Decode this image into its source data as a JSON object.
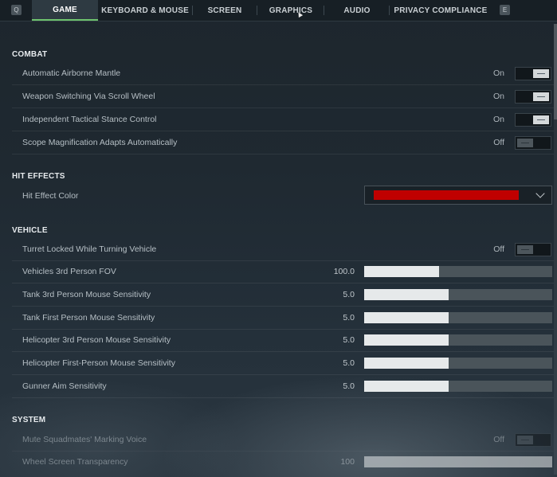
{
  "tabs": {
    "left_key": "Q",
    "right_key": "E",
    "items": [
      {
        "label": "GAME",
        "active": true
      },
      {
        "label": "KEYBOARD & MOUSE",
        "active": false
      },
      {
        "label": "SCREEN",
        "active": false
      },
      {
        "label": "GRAPHICS",
        "active": false
      },
      {
        "label": "AUDIO",
        "active": false
      },
      {
        "label": "PRIVACY COMPLIANCE",
        "active": false
      }
    ]
  },
  "combat": {
    "title": "COMBAT",
    "rows": [
      {
        "label": "Automatic Airborne Mantle",
        "state": "On"
      },
      {
        "label": "Weapon Switching Via Scroll Wheel",
        "state": "On"
      },
      {
        "label": "Independent Tactical Stance Control",
        "state": "On"
      },
      {
        "label": "Scope Magnification Adapts Automatically",
        "state": "Off"
      }
    ]
  },
  "hit_effects": {
    "title": "HIT EFFECTS",
    "rows": [
      {
        "label": "Hit Effect Color",
        "color": "#c00000"
      }
    ]
  },
  "vehicle": {
    "title": "VEHICLE",
    "toggle_row": {
      "label": "Turret Locked While Turning Vehicle",
      "state": "Off"
    },
    "sliders": [
      {
        "label": "Vehicles 3rd Person FOV",
        "value": "100.0",
        "fraction": 0.4
      },
      {
        "label": "Tank 3rd Person Mouse Sensitivity",
        "value": "5.0",
        "fraction": 0.45
      },
      {
        "label": "Tank First Person Mouse Sensitivity",
        "value": "5.0",
        "fraction": 0.45
      },
      {
        "label": "Helicopter 3rd Person Mouse Sensitivity",
        "value": "5.0",
        "fraction": 0.45
      },
      {
        "label": "Helicopter First-Person Mouse Sensitivity",
        "value": "5.0",
        "fraction": 0.45
      },
      {
        "label": "Gunner Aim Sensitivity",
        "value": "5.0",
        "fraction": 0.45
      }
    ]
  },
  "system": {
    "title": "SYSTEM",
    "toggle_row": {
      "label": "Mute Squadmates' Marking Voice",
      "state": "Off"
    },
    "slider_row": {
      "label": "Wheel Screen Transparency",
      "value": "100",
      "fraction": 1.0
    }
  },
  "colors": {
    "accent": "#6ec36e",
    "hit_color": "#c00000"
  }
}
